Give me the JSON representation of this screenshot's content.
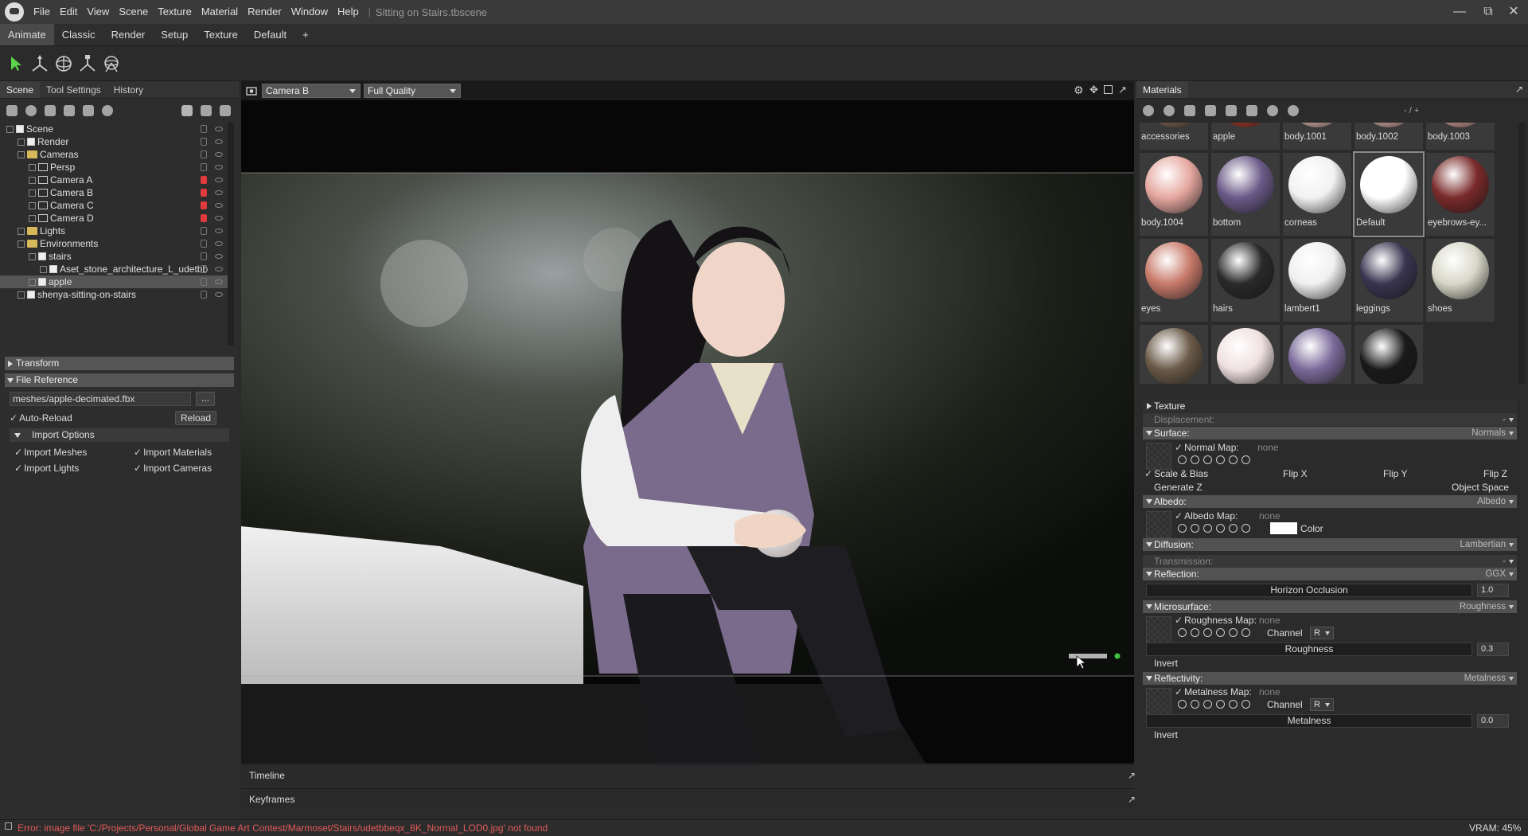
{
  "window": {
    "menus": [
      "File",
      "Edit",
      "View",
      "Scene",
      "Texture",
      "Material",
      "Render",
      "Window",
      "Help"
    ],
    "document": "Sitting on Stairs.tbscene"
  },
  "workspace_tabs": [
    "Animate",
    "Classic",
    "Render",
    "Setup",
    "Texture",
    "Default",
    "+"
  ],
  "scene_panel": {
    "tabs": [
      "Scene",
      "Tool Settings",
      "History"
    ],
    "tree": [
      {
        "label": "Scene",
        "indent": 0,
        "icon": "scene",
        "lock": "normal"
      },
      {
        "label": "Render",
        "indent": 1,
        "icon": "render",
        "lock": "normal"
      },
      {
        "label": "Cameras",
        "indent": 1,
        "icon": "folder",
        "lock": "normal"
      },
      {
        "label": "Persp",
        "indent": 2,
        "icon": "camera",
        "lock": "normal"
      },
      {
        "label": "Camera A",
        "indent": 2,
        "icon": "camera",
        "lock": "red"
      },
      {
        "label": "Camera B",
        "indent": 2,
        "icon": "camera",
        "lock": "red"
      },
      {
        "label": "Camera C",
        "indent": 2,
        "icon": "camera",
        "lock": "red"
      },
      {
        "label": "Camera D",
        "indent": 2,
        "icon": "camera",
        "lock": "red"
      },
      {
        "label": "Lights",
        "indent": 1,
        "icon": "folder",
        "lock": "normal"
      },
      {
        "label": "Environments",
        "indent": 1,
        "icon": "folder",
        "lock": "normal"
      },
      {
        "label": "stairs",
        "indent": 2,
        "icon": "object",
        "lock": "normal"
      },
      {
        "label": "Aset_stone_architecture_L_udetbb",
        "indent": 3,
        "icon": "mesh",
        "lock": "normal"
      },
      {
        "label": "apple",
        "indent": 2,
        "icon": "object",
        "lock": "normal",
        "selected": true
      },
      {
        "label": "shenya-sitting-on-stairs",
        "indent": 1,
        "icon": "object",
        "lock": "normal"
      }
    ]
  },
  "properties": {
    "transform": "Transform",
    "file_reference": "File Reference",
    "file_path": "meshes/apple-decimated.fbx",
    "browse": "...",
    "auto_reload": "Auto-Reload",
    "reload": "Reload",
    "import_options": "Import Options",
    "import_meshes": "Import Meshes",
    "import_materials": "Import Materials",
    "import_lights": "Import Lights",
    "import_cameras": "Import Cameras"
  },
  "viewport": {
    "camera": "Camera B",
    "quality": "Full Quality"
  },
  "timeline": "Timeline",
  "keyframes": "Keyframes",
  "materials_panel": {
    "title": "Materials",
    "paging": "- / +",
    "materials": [
      {
        "name": "accessories",
        "color": "#8a6a55"
      },
      {
        "name": "apple",
        "color": "#b03a2a"
      },
      {
        "name": "body.1001",
        "color": "#e8c0b5"
      },
      {
        "name": "body.1002",
        "color": "#e6b8b0"
      },
      {
        "name": "body.1003",
        "color": "#e0aaa0"
      },
      {
        "name": "body.1004",
        "color": "#e6a8a0"
      },
      {
        "name": "bottom",
        "color": "#6a5a88"
      },
      {
        "name": "corneas",
        "color": "#f2f2f2"
      },
      {
        "name": "Default",
        "color": "#ffffff",
        "selected": true
      },
      {
        "name": "eyebrows-ey...",
        "color": "#7a2a2a"
      },
      {
        "name": "eyes",
        "color": "#c87a6a"
      },
      {
        "name": "hairs",
        "color": "#2a2a2a"
      },
      {
        "name": "lambert1",
        "color": "#f0f0f0"
      },
      {
        "name": "leggings",
        "color": "#3a3550"
      },
      {
        "name": "shoes",
        "color": "#d8d8c8"
      },
      {
        "name": "",
        "color": "#6a5a48"
      },
      {
        "name": "",
        "color": "#f0e0e0"
      },
      {
        "name": "",
        "color": "#7a6a9a"
      },
      {
        "name": "",
        "color": "#1a1a1a"
      }
    ],
    "settings": {
      "texture": "Texture",
      "displacement": "Displacement:",
      "displacement_val": "-",
      "surface": "Surface:",
      "surface_val": "Normals",
      "normal_map": "Normal Map:",
      "none": "none",
      "scale_bias": "Scale & Bias",
      "flip_x": "Flip X",
      "flip_y": "Flip Y",
      "flip_z": "Flip Z",
      "generate_z": "Generate Z",
      "object_space": "Object Space",
      "albedo": "Albedo:",
      "albedo_val": "Albedo",
      "albedo_map": "Albedo Map:",
      "color": "Color",
      "diffusion": "Diffusion:",
      "diffusion_val": "Lambertian",
      "transmission": "Transmission:",
      "transmission_val": "-",
      "reflection": "Reflection:",
      "reflection_val": "GGX",
      "horizon": "Horizon Occlusion",
      "horizon_val": "1.0",
      "microsurface": "Microsurface:",
      "microsurface_val": "Roughness",
      "roughness_map": "Roughness Map:",
      "channel": "Channel",
      "channel_val": "R",
      "roughness": "Roughness",
      "roughness_val": "0.3",
      "invert": "Invert",
      "reflectivity": "Reflectivity:",
      "reflectivity_val": "Metalness",
      "metalness_map": "Metalness Map:",
      "metalness": "Metalness",
      "metalness_val": "0.0"
    }
  },
  "status": {
    "error": "Error: image file 'C:/Projects/Personal/Global Game Art Contest/Marmoset/Stairs/udetbbeqx_8K_Normal_LOD0.jpg' not found",
    "vram": "VRAM: 45%"
  }
}
